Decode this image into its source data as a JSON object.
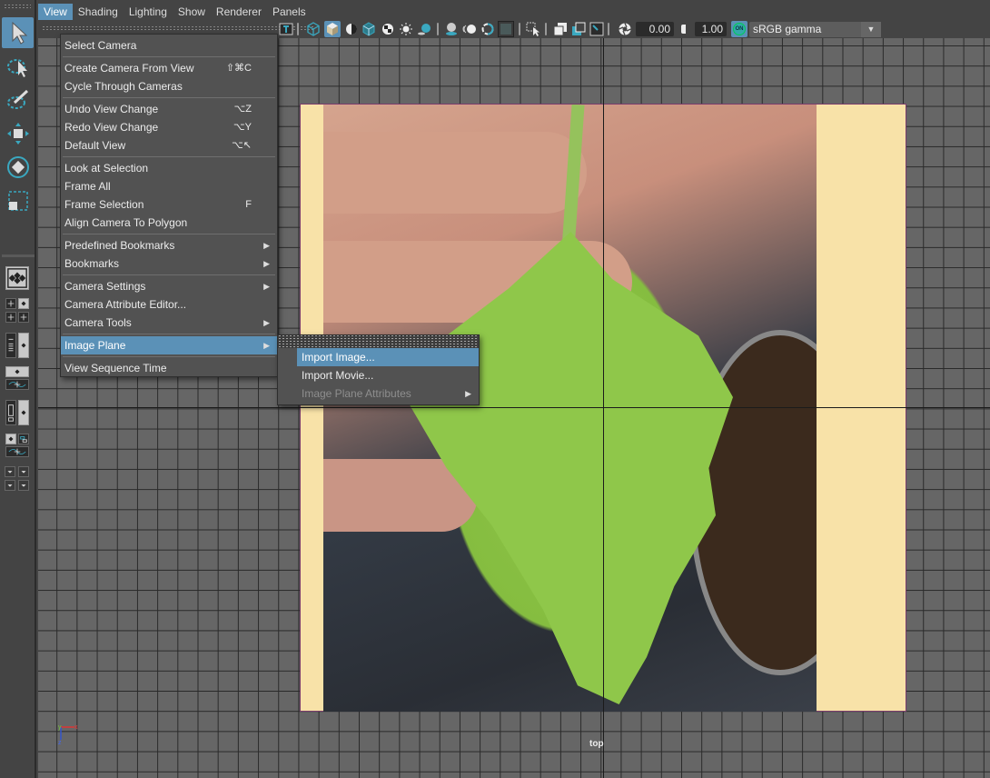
{
  "menubar": {
    "items": [
      "View",
      "Shading",
      "Lighting",
      "Show",
      "Renderer",
      "Panels"
    ],
    "active": "View"
  },
  "toolbar": {
    "exposure_value": "0.00",
    "gamma_value": "1.00",
    "color_mgmt_badge": "ON",
    "color_space": "sRGB gamma",
    "icons": [
      "text-icon",
      "wireframe-cube-icon",
      "shaded-cube-icon",
      "half-shaded-icon",
      "wireframe-on-shaded-icon",
      "checker-icon",
      "light-icon",
      "shadow-icon",
      "xray-icon",
      "xray-joint-icon",
      "ambient-occlusion-icon",
      "isolate-icon",
      "select-camera-icon",
      "film-gate-icon",
      "resolution-gate-icon",
      "image-plane-icon",
      "exposure-icon",
      "gamma-icon"
    ]
  },
  "view_menu": {
    "groups": [
      [
        {
          "label": "Select Camera",
          "shortcut": ""
        }
      ],
      [
        {
          "label": "Create Camera From View",
          "shortcut": "⇧⌘C"
        },
        {
          "label": "Cycle Through Cameras",
          "shortcut": ""
        }
      ],
      [
        {
          "label": "Undo View Change",
          "shortcut": "⌥Z"
        },
        {
          "label": "Redo View Change",
          "shortcut": "⌥Y"
        },
        {
          "label": "Default View",
          "shortcut": "⌥↖"
        }
      ],
      [
        {
          "label": "Look at Selection",
          "shortcut": ""
        },
        {
          "label": "Frame All",
          "shortcut": ""
        },
        {
          "label": "Frame Selection",
          "shortcut": "F"
        },
        {
          "label": "Align Camera To Polygon",
          "shortcut": ""
        }
      ],
      [
        {
          "label": "Predefined Bookmarks",
          "submenu": true
        },
        {
          "label": "Bookmarks",
          "submenu": true
        }
      ],
      [
        {
          "label": "Camera Settings",
          "submenu": true
        },
        {
          "label": "Camera Attribute Editor...",
          "shortcut": ""
        },
        {
          "label": "Camera Tools",
          "submenu": true
        }
      ],
      [
        {
          "label": "Image Plane",
          "submenu": true,
          "highlighted": true
        }
      ],
      [
        {
          "label": "View Sequence Time",
          "shortcut": ""
        }
      ]
    ]
  },
  "image_plane_submenu": {
    "items": [
      {
        "label": "Import Image...",
        "highlighted": true
      },
      {
        "label": "Import Movie..."
      },
      {
        "label": "Image Plane Attributes",
        "disabled": true,
        "submenu": true
      }
    ]
  },
  "viewport": {
    "camera_label": "top",
    "gizmo_axes": [
      "x",
      "y",
      "z"
    ]
  },
  "toolbox": {
    "tools": [
      "select-tool",
      "lasso-tool",
      "paint-select-tool",
      "move-tool",
      "rotate-tool",
      "scale-tool"
    ],
    "active_tool": "select-tool"
  },
  "colors": {
    "accent": "#5b91b7",
    "menu_bg": "#525252",
    "viewport_bg": "#666666",
    "image_plane_bg": "#f8e2a8"
  }
}
